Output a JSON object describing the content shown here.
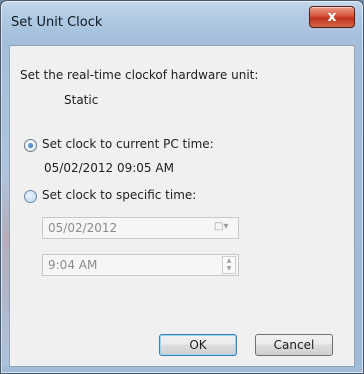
{
  "window": {
    "title": "Set Unit Clock",
    "close_glyph": "x"
  },
  "intro": {
    "label": "Set the real-time clockof hardware unit:",
    "mode": "Static"
  },
  "option_pc": {
    "label": "Set clock to current PC time:",
    "value": "05/02/2012 09:05 AM",
    "checked": true
  },
  "option_specific": {
    "label": "Set clock to specific time:",
    "checked": false
  },
  "date_input": {
    "value": "05/02/2012"
  },
  "time_input": {
    "value": "9:04 AM"
  },
  "buttons": {
    "ok": "OK",
    "cancel": "Cancel"
  }
}
